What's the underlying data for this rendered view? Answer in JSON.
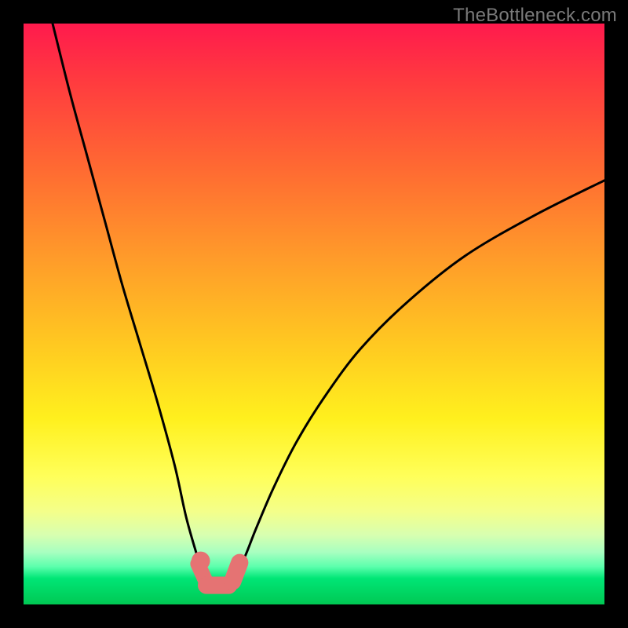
{
  "watermark": "TheBottleneck.com",
  "chart_data": {
    "type": "line",
    "title": "",
    "xlabel": "",
    "ylabel": "",
    "xlim": [
      0,
      100
    ],
    "ylim": [
      0,
      100
    ],
    "series": [
      {
        "name": "bottleneck-curve",
        "x": [
          5,
          8,
          11,
          14,
          17,
          20,
          23,
          26,
          28,
          30,
          31,
          32,
          33,
          34,
          35,
          36,
          38,
          40,
          43,
          47,
          52,
          58,
          66,
          76,
          88,
          100
        ],
        "values": [
          100,
          88,
          77,
          66,
          55,
          45,
          35,
          24,
          15,
          8,
          5,
          3.5,
          3,
          3,
          3.3,
          4.5,
          8,
          13,
          20,
          28,
          36,
          44,
          52,
          60,
          67,
          73
        ]
      }
    ],
    "markers": [
      {
        "name": "marker-left-dot",
        "x": 30.5,
        "y": 7.5,
        "r": 1.6
      },
      {
        "name": "marker-left-bar",
        "x1": 30.0,
        "y1": 7.0,
        "x2": 31.5,
        "y2": 3.7,
        "w": 2.6
      },
      {
        "name": "marker-bottom-bar",
        "x1": 31.5,
        "y1": 3.3,
        "x2": 35.3,
        "y2": 3.3,
        "w": 3.0
      },
      {
        "name": "marker-right-bar",
        "x1": 36.0,
        "y1": 4.0,
        "x2": 37.2,
        "y2": 7.2,
        "w": 3.0
      }
    ],
    "colors": {
      "curve": "#000000",
      "marker": "#e57373"
    }
  }
}
